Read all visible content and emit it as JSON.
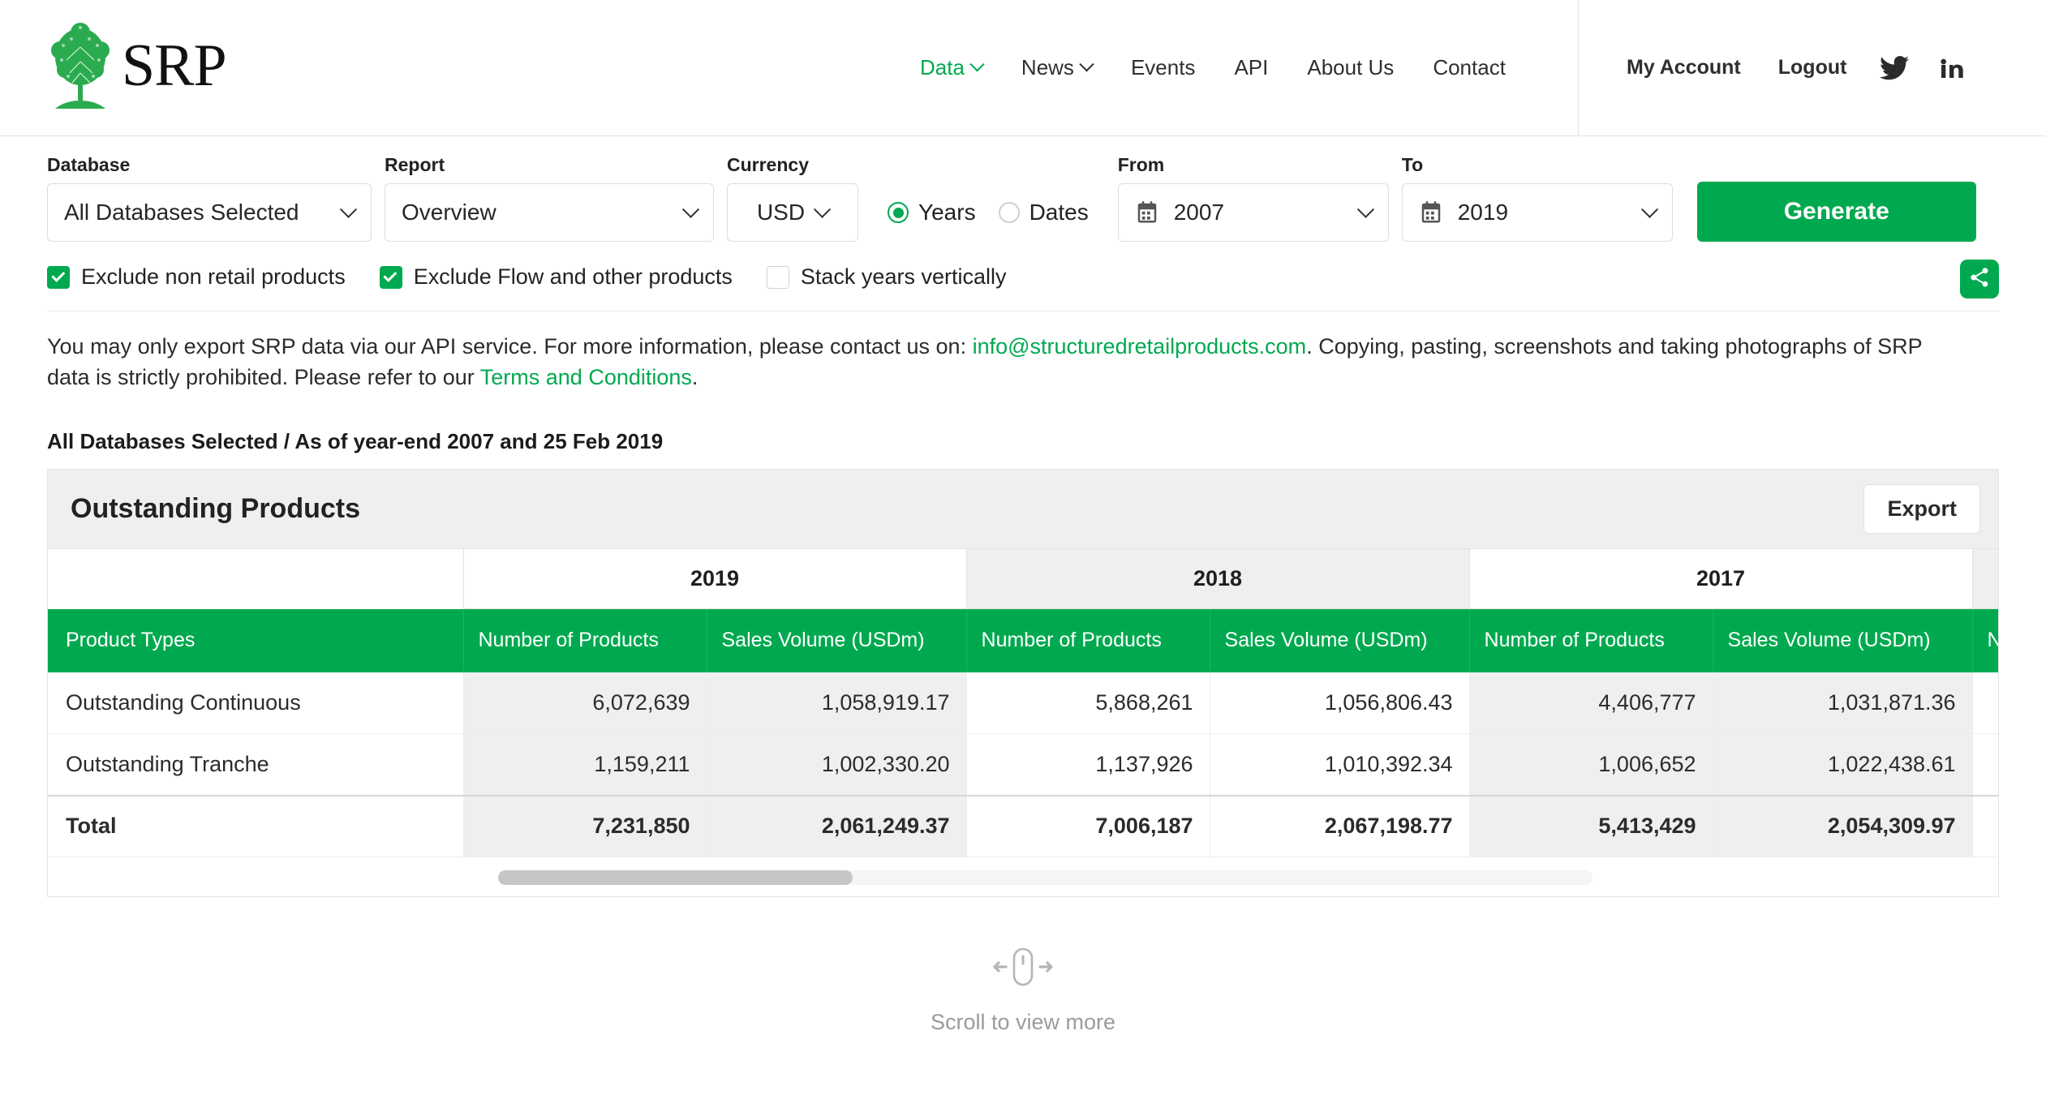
{
  "brand": {
    "name": "SRP",
    "logo_icon": "tree-icon"
  },
  "nav": {
    "items": [
      {
        "label": "Data",
        "has_chevron": true,
        "active": true
      },
      {
        "label": "News",
        "has_chevron": true,
        "active": false
      },
      {
        "label": "Events",
        "has_chevron": false,
        "active": false
      },
      {
        "label": "API",
        "has_chevron": false,
        "active": false
      },
      {
        "label": "About Us",
        "has_chevron": false,
        "active": false
      },
      {
        "label": "Contact",
        "has_chevron": false,
        "active": false
      }
    ],
    "user": [
      {
        "label": "My Account"
      },
      {
        "label": "Logout"
      }
    ],
    "social": [
      {
        "icon": "twitter-icon"
      },
      {
        "icon": "linkedin-icon"
      }
    ]
  },
  "filters": {
    "database": {
      "label": "Database",
      "value": "All Databases Selected"
    },
    "report": {
      "label": "Report",
      "value": "Overview"
    },
    "currency": {
      "label": "Currency",
      "value": "USD"
    },
    "mode": {
      "years_label": "Years",
      "dates_label": "Dates",
      "selected": "Years"
    },
    "from": {
      "label": "From",
      "value": "2007",
      "icon": "calendar-icon"
    },
    "to": {
      "label": "To",
      "value": "2019",
      "icon": "calendar-icon"
    },
    "generate_label": "Generate",
    "checkboxes": [
      {
        "label": "Exclude non retail products",
        "checked": true
      },
      {
        "label": "Exclude Flow and other products",
        "checked": true
      },
      {
        "label": "Stack years vertically",
        "checked": false
      }
    ],
    "share_icon": "share-icon"
  },
  "disclaimer": {
    "part1": "You may only export SRP data via our API service. For more information, please contact us on: ",
    "email": "info@structuredretailproducts.com",
    "part2": ". Copying, pasting, screenshots and taking photographs of SRP data is strictly prohibited. Please refer to our ",
    "terms": "Terms and Conditions",
    "part3": "."
  },
  "results": {
    "context_line": "All Databases Selected / As of year-end 2007 and 25 Feb 2019",
    "panel_title": "Outstanding Products",
    "export_label": "Export",
    "table": {
      "row_header_label": "Product Types",
      "years": [
        "2019",
        "2018",
        "2017",
        ""
      ],
      "sub_headers": [
        "Number of Products",
        "Sales Volume (USDm)"
      ],
      "rows": [
        {
          "name": "Outstanding Continuous",
          "cells": [
            "6,072,639",
            "1,058,919.17",
            "5,868,261",
            "1,056,806.43",
            "4,406,777",
            "1,031,871.36",
            ""
          ]
        },
        {
          "name": "Outstanding Tranche",
          "cells": [
            "1,159,211",
            "1,002,330.20",
            "1,137,926",
            "1,010,392.34",
            "1,006,652",
            "1,022,438.61",
            ""
          ]
        }
      ],
      "total": {
        "name": "Total",
        "cells": [
          "7,231,850",
          "2,061,249.37",
          "7,006,187",
          "2,067,198.77",
          "5,413,429",
          "2,054,309.97",
          ""
        ]
      }
    },
    "scroll_hint": {
      "label": "Scroll to view more",
      "icon": "mouse-scroll-icon"
    }
  },
  "colors": {
    "brand_green": "#00a94f",
    "header_green": "#00a94f",
    "link_green": "#00a94f",
    "panel_gray": "#efefef",
    "cell_gray": "#efefef"
  }
}
